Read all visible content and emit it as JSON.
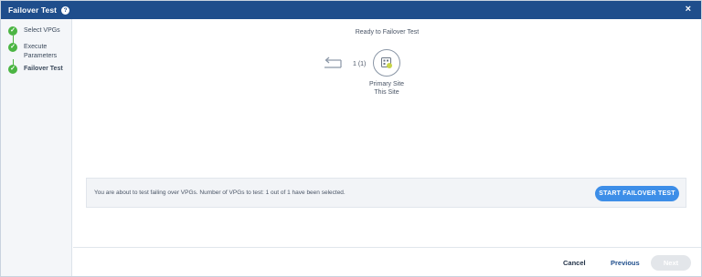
{
  "window": {
    "title": "Failover Test",
    "help_icon": "help-icon",
    "close_label": "×"
  },
  "sidebar": {
    "steps": [
      {
        "label": "Select VPGs",
        "status": "complete"
      },
      {
        "label": "Execute Parameters",
        "status": "complete"
      },
      {
        "label": "Failover Test",
        "status": "current"
      }
    ]
  },
  "main": {
    "status_text": "Ready to Failover Test",
    "vpg_count": "1 (1)",
    "site": {
      "name": "Primary Site",
      "subtitle": "This Site",
      "icon": "site-icon"
    },
    "info_text": "You are about to test failing over VPGs. Number of VPGs to test: 1 out of 1 have been selected.",
    "start_button": "START FAILOVER TEST"
  },
  "footer": {
    "cancel": "Cancel",
    "previous": "Previous",
    "next": "Next"
  },
  "colors": {
    "titlebar": "#1f4e8c",
    "step_complete": "#4bb543",
    "primary_button": "#3d8ee8",
    "disabled_button": "#e3e6ea"
  }
}
